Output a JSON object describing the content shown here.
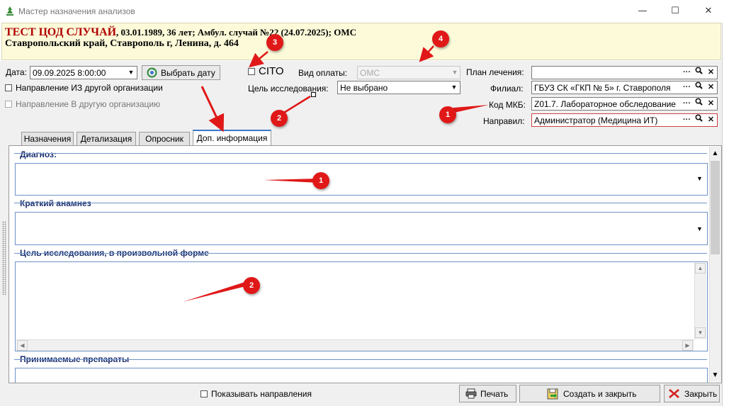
{
  "window": {
    "title": "Мастер назначения анализов",
    "minimize_glyph": "—",
    "maximize_glyph": "☐",
    "close_glyph": "✕"
  },
  "patient": {
    "name": "ТЕСТ ЦОД СЛУЧАЙ",
    "details": ", 03.01.1989, 36 лет; Амбул. случай №22 (24.07.2025); ОМС",
    "address": "Ставропольский край, Ставрополь г, Ленина, д. 464"
  },
  "form": {
    "date_label": "Дата:",
    "date_value": "09.09.2025 8:00:00",
    "pick_date_button": "Выбрать дату",
    "cito_label": "CITO",
    "payment_label": "Вид оплаты:",
    "payment_value": "ОМС",
    "treatment_plan_label": "План лечения:",
    "treatment_plan_value": "",
    "direction_from_other_org": "Направление ИЗ другой организации",
    "direction_to_other_org": "Направление В другую организацию",
    "research_goal_label": "Цель исследования:",
    "research_goal_value": "Не выбрано",
    "branch_label": "Филиал:",
    "branch_value": "ГБУЗ СК «ГКП № 5» г. Ставрополя",
    "mkb_label": "Код МКБ:",
    "mkb_value": "Z01.7. Лабораторное обследование",
    "referred_by_label": "Направил:",
    "referred_by_value": "Администратор (Медицина ИТ)",
    "ellipsis_glyph": "···",
    "search_glyph": "🔍",
    "clear_glyph": "✕"
  },
  "tabs": [
    "Назначения",
    "Детализация",
    "Опросник",
    "Доп. информация"
  ],
  "active_tab": "Доп. информация",
  "groups": {
    "diagnosis": "Диагноз:",
    "anamnesis": "Краткий анамнез",
    "free_goal": "Цель исследования, в произвольной форме",
    "medications": "Принимаемые препараты"
  },
  "bottom": {
    "show_directions": "Показывать направления",
    "print_button": "Печать",
    "create_close_button": "Создать и закрыть",
    "close_button": "Закрыть"
  },
  "annotations": [
    "1",
    "2",
    "3",
    "4",
    "1",
    "2"
  ],
  "colors": {
    "annotation_red": "#e01818",
    "patient_name": "#b00000",
    "patient_header_bg": "#fcfad9",
    "group_border": "#6f93c7",
    "tab_accent": "#3b78c9"
  }
}
